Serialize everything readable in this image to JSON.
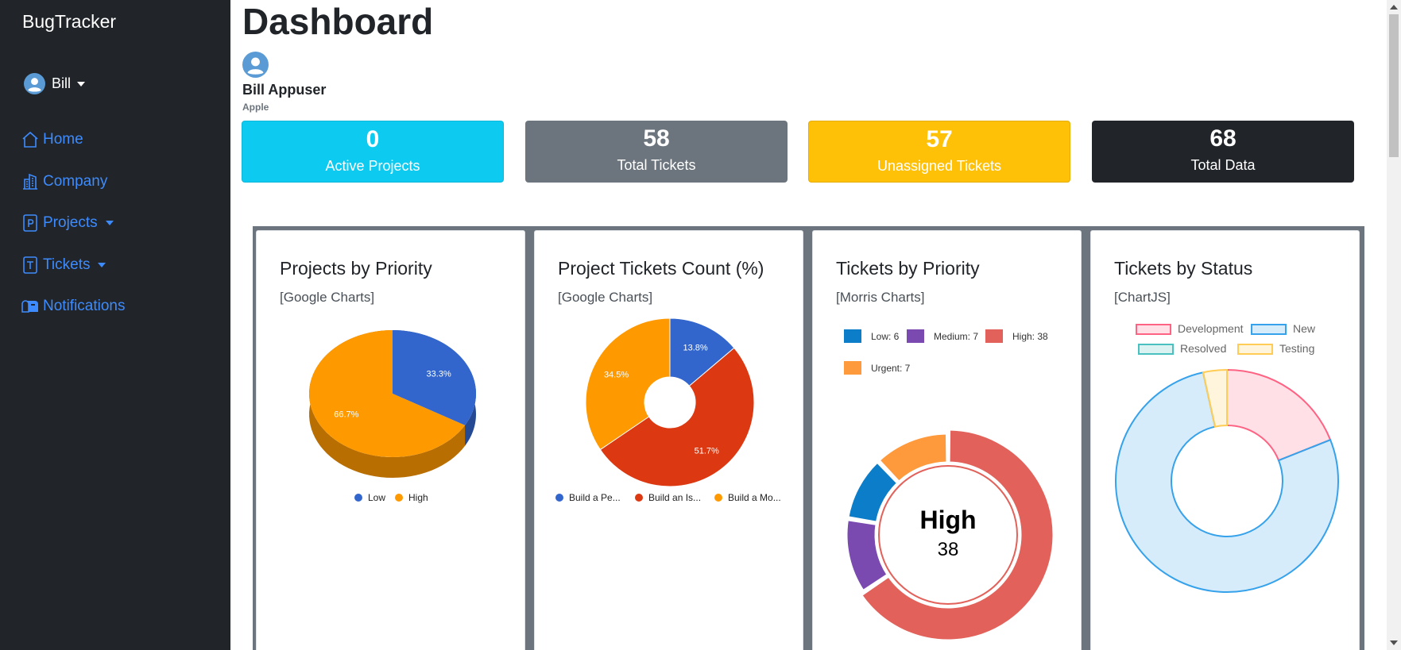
{
  "app": {
    "brand": "BugTracker"
  },
  "user_menu": {
    "name": "Bill",
    "avatar_icon": "user-circle-icon"
  },
  "sidebar": {
    "items": [
      {
        "label": "Home",
        "icon": "house-icon"
      },
      {
        "label": "Company",
        "icon": "building-icon"
      },
      {
        "label": "Projects",
        "icon": "file-p-icon",
        "dropdown": true
      },
      {
        "label": "Tickets",
        "icon": "file-t-icon",
        "dropdown": true
      },
      {
        "label": "Notifications",
        "icon": "mailbox-icon"
      }
    ]
  },
  "page": {
    "title": "Dashboard"
  },
  "profile": {
    "name": "Bill Appuser",
    "company": "Apple"
  },
  "stats": [
    {
      "value": "0",
      "label": "Active Projects",
      "color": "#0dcaf0"
    },
    {
      "value": "58",
      "label": "Total Tickets",
      "color": "#6c757d"
    },
    {
      "value": "57",
      "label": "Unassigned Tickets",
      "color": "#ffc107"
    },
    {
      "value": "68",
      "label": "Total Data",
      "color": "#212529"
    }
  ],
  "cards": [
    {
      "title": "Projects by Priority",
      "subtitle": "[Google Charts]"
    },
    {
      "title": "Project Tickets Count (%)",
      "subtitle": "[Google Charts]"
    },
    {
      "title": "Tickets by Priority",
      "subtitle": "[Morris Charts]"
    },
    {
      "title": "Tickets by Status",
      "subtitle": "[ChartJS]"
    }
  ],
  "chart_data": [
    {
      "type": "pie",
      "title": "Projects by Priority",
      "categories": [
        "Low",
        "High"
      ],
      "values": [
        33.3,
        66.7
      ],
      "labels": [
        "33.3%",
        "66.7%"
      ],
      "colors": [
        "#3366cc",
        "#ff9900"
      ],
      "legend": "bottom"
    },
    {
      "type": "pie",
      "title": "Project Tickets Count (%)",
      "categories": [
        "Build a Pe...",
        "Build an Is...",
        "Build a Mo..."
      ],
      "values": [
        13.8,
        51.7,
        34.5
      ],
      "labels": [
        "13.8%",
        "51.7%",
        "34.5%"
      ],
      "colors": [
        "#3366cc",
        "#dc3912",
        "#ff9900"
      ],
      "legend": "bottom"
    },
    {
      "type": "pie",
      "title": "Tickets by Priority",
      "categories": [
        "Low",
        "Medium",
        "High",
        "Urgent"
      ],
      "values": [
        6,
        7,
        38,
        7
      ],
      "legend_labels": [
        "Low: 6",
        "Medium: 7",
        "High: 38",
        "Urgent: 7"
      ],
      "colors": [
        "#0b7dc9",
        "#7a4ab0",
        "#e2615a",
        "#ff9a3c"
      ],
      "center_label": "High",
      "center_value": "38",
      "legend": "top"
    },
    {
      "type": "pie",
      "title": "Tickets by Status",
      "categories": [
        "Development",
        "New",
        "Resolved",
        "Testing"
      ],
      "values": [
        11,
        45,
        0,
        2
      ],
      "colors": [
        "#ff6384",
        "#36a2eb",
        "#4bc0c0",
        "#ffcd56"
      ],
      "legend": "top"
    }
  ]
}
